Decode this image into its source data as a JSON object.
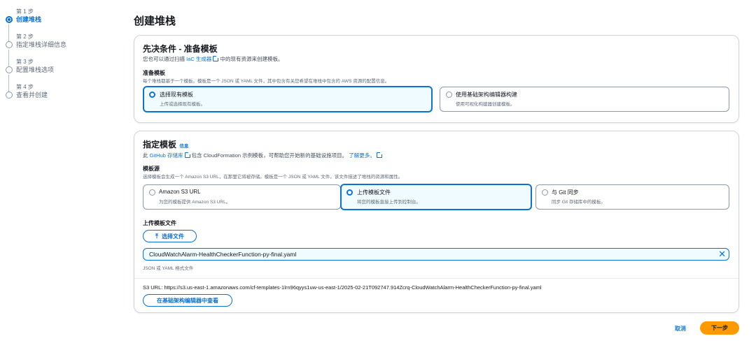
{
  "steps": [
    {
      "num": "第 1 步",
      "name": "创建堆栈"
    },
    {
      "num": "第 2 步",
      "name": "指定堆栈详细信息"
    },
    {
      "num": "第 3 步",
      "name": "配置堆栈选项"
    },
    {
      "num": "第 4 步",
      "name": "查看并创建"
    }
  ],
  "page_title": "创建堆栈",
  "prereq": {
    "title": "先决条件 - 准备模板",
    "desc_pre": "您也可以通过扫描",
    "desc_link": "IaC 生成器",
    "desc_post": "中的现有资源来创建模板。",
    "prepare_label": "准备模板",
    "prepare_desc": "每个堆栈都基于一个模板。模板是一个 JSON 或 YAML 文件，其中包含有关您希望在堆栈中包含的 AWS 资源的配置信息。",
    "options": [
      {
        "label": "选择现有模板",
        "desc": "上传或选择现有模板。"
      },
      {
        "label": "使用基础架构编辑器构建",
        "desc": "使用可视化构建器创建模板。"
      }
    ]
  },
  "specify": {
    "title": "指定模板",
    "info": "信息",
    "desc_pre": "此",
    "desc_link": "GitHub 存储库",
    "desc_mid": "包含 CloudFormation 示例模板，可帮助您开始新的基础设施项目。",
    "learn_more": "了解更多。",
    "source_label": "模板源",
    "source_desc": "选择模板会生成一个 Amazon S3 URL，在那里它将被存储。模板是一个 JSON 或 YAML 文件，该文件描述了堆栈的资源和属性。",
    "sources": [
      {
        "label": "Amazon S3 URL",
        "desc": "为您的模板提供 Amazon S3 URL。"
      },
      {
        "label": "上传模板文件",
        "desc": "将您的模板直接上传到控制台。"
      },
      {
        "label": "与 Git 同步",
        "desc": "同步 Git 存储库中的模板。"
      }
    ],
    "upload_label": "上传模板文件",
    "choose_file": "选择文件",
    "file_name": "CloudWatchAlarm-HealthCheckerFunction-py-final.yaml",
    "file_hint": "JSON 或 YAML 格式文件",
    "s3_url_label": "S3 URL:",
    "s3_url": "https://s3.us-east-1.amazonaws.com/cf-templates-1lrn96qyys1uw-us-east-1/2025-02-21T092747.914Zcrq-CloudWatchAlarm-HealthCheckerFunction-py-final.yaml",
    "view_in_editor": "在基础架构编辑器中查看"
  },
  "footer": {
    "cancel": "取消",
    "next": "下一步"
  },
  "colors": {
    "accent": "#0972d3",
    "primary_button": "#ff9900"
  }
}
